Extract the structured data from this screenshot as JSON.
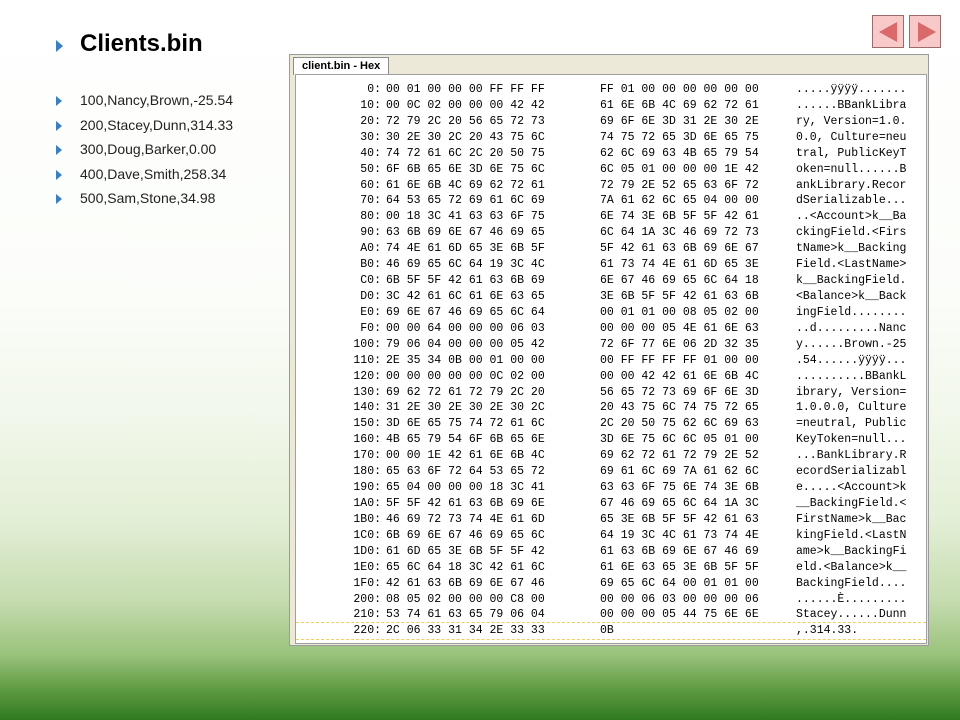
{
  "slide": {
    "title": "Clients.bin",
    "clients": [
      "100,Nancy,Brown,-25.54",
      "200,Stacey,Dunn,314.33",
      "300,Doug,Barker,0.00",
      "400,Dave,Smith,258.34",
      "500,Sam,Stone,34.98"
    ],
    "bullet_icon": "triangle-right-icon",
    "nav": {
      "prev_icon": "triangle-left-icon",
      "next_icon": "triangle-right-icon"
    }
  },
  "hex_viewer": {
    "tab_title": "client.bin - Hex",
    "rows": [
      {
        "offset": "0:",
        "bytes1": "00 01 00 00 00 FF FF FF",
        "bytes2": "FF 01 00 00 00 00 00 00",
        "ascii": ".....ÿÿÿÿ......."
      },
      {
        "offset": "10:",
        "bytes1": "00 0C 02 00 00 00 42 42",
        "bytes2": "61 6E 6B 4C 69 62 72 61",
        "ascii": "......BBankLibra"
      },
      {
        "offset": "20:",
        "bytes1": "72 79 2C 20 56 65 72 73",
        "bytes2": "69 6F 6E 3D 31 2E 30 2E",
        "ascii": "ry, Version=1.0."
      },
      {
        "offset": "30:",
        "bytes1": "30 2E 30 2C 20 43 75 6C",
        "bytes2": "74 75 72 65 3D 6E 65 75",
        "ascii": "0.0, Culture=neu"
      },
      {
        "offset": "40:",
        "bytes1": "74 72 61 6C 2C 20 50 75",
        "bytes2": "62 6C 69 63 4B 65 79 54",
        "ascii": "tral, PublicKeyT"
      },
      {
        "offset": "50:",
        "bytes1": "6F 6B 65 6E 3D 6E 75 6C",
        "bytes2": "6C 05 01 00 00 00 1E 42",
        "ascii": "oken=null......B"
      },
      {
        "offset": "60:",
        "bytes1": "61 6E 6B 4C 69 62 72 61",
        "bytes2": "72 79 2E 52 65 63 6F 72",
        "ascii": "ankLibrary.Recor"
      },
      {
        "offset": "70:",
        "bytes1": "64 53 65 72 69 61 6C 69",
        "bytes2": "7A 61 62 6C 65 04 00 00",
        "ascii": "dSerializable..."
      },
      {
        "offset": "80:",
        "bytes1": "00 18 3C 41 63 63 6F 75",
        "bytes2": "6E 74 3E 6B 5F 5F 42 61",
        "ascii": "..<Account>k__Ba"
      },
      {
        "offset": "90:",
        "bytes1": "63 6B 69 6E 67 46 69 65",
        "bytes2": "6C 64 1A 3C 46 69 72 73",
        "ascii": "ckingField.<Firs"
      },
      {
        "offset": "A0:",
        "bytes1": "74 4E 61 6D 65 3E 6B 5F",
        "bytes2": "5F 42 61 63 6B 69 6E 67",
        "ascii": "tName>k__Backing"
      },
      {
        "offset": "B0:",
        "bytes1": "46 69 65 6C 64 19 3C 4C",
        "bytes2": "61 73 74 4E 61 6D 65 3E",
        "ascii": "Field.<LastName>"
      },
      {
        "offset": "C0:",
        "bytes1": "6B 5F 5F 42 61 63 6B 69",
        "bytes2": "6E 67 46 69 65 6C 64 18",
        "ascii": "k__BackingField."
      },
      {
        "offset": "D0:",
        "bytes1": "3C 42 61 6C 61 6E 63 65",
        "bytes2": "3E 6B 5F 5F 42 61 63 6B",
        "ascii": "<Balance>k__Back"
      },
      {
        "offset": "E0:",
        "bytes1": "69 6E 67 46 69 65 6C 64",
        "bytes2": "00 01 01 00 08 05 02 00",
        "ascii": "ingField........"
      },
      {
        "offset": "F0:",
        "bytes1": "00 00 64 00 00 00 06 03",
        "bytes2": "00 00 00 05 4E 61 6E 63",
        "ascii": "..d.........Nanc"
      },
      {
        "offset": "100:",
        "bytes1": "79 06 04 00 00 00 05 42",
        "bytes2": "72 6F 77 6E 06 2D 32 35",
        "ascii": "y......Brown.-25"
      },
      {
        "offset": "110:",
        "bytes1": "2E 35 34 0B 00 01 00 00",
        "bytes2": "00 FF FF FF FF 01 00 00",
        "ascii": ".54......ÿÿÿÿ..."
      },
      {
        "offset": "120:",
        "bytes1": "00 00 00 00 00 0C 02 00",
        "bytes2": "00 00 42 42 61 6E 6B 4C",
        "ascii": "..........BBankL"
      },
      {
        "offset": "130:",
        "bytes1": "69 62 72 61 72 79 2C 20",
        "bytes2": "56 65 72 73 69 6F 6E 3D",
        "ascii": "ibrary, Version="
      },
      {
        "offset": "140:",
        "bytes1": "31 2E 30 2E 30 2E 30 2C",
        "bytes2": "20 43 75 6C 74 75 72 65",
        "ascii": "1.0.0.0, Culture"
      },
      {
        "offset": "150:",
        "bytes1": "3D 6E 65 75 74 72 61 6C",
        "bytes2": "2C 20 50 75 62 6C 69 63",
        "ascii": "=neutral, Public"
      },
      {
        "offset": "160:",
        "bytes1": "4B 65 79 54 6F 6B 65 6E",
        "bytes2": "3D 6E 75 6C 6C 05 01 00",
        "ascii": "KeyToken=null..."
      },
      {
        "offset": "170:",
        "bytes1": "00 00 1E 42 61 6E 6B 4C",
        "bytes2": "69 62 72 61 72 79 2E 52",
        "ascii": "...BankLibrary.R"
      },
      {
        "offset": "180:",
        "bytes1": "65 63 6F 72 64 53 65 72",
        "bytes2": "69 61 6C 69 7A 61 62 6C",
        "ascii": "ecordSerializabl"
      },
      {
        "offset": "190:",
        "bytes1": "65 04 00 00 00 18 3C 41",
        "bytes2": "63 63 6F 75 6E 74 3E 6B",
        "ascii": "e.....<Account>k"
      },
      {
        "offset": "1A0:",
        "bytes1": "5F 5F 42 61 63 6B 69 6E",
        "bytes2": "67 46 69 65 6C 64 1A 3C",
        "ascii": "__BackingField.<"
      },
      {
        "offset": "1B0:",
        "bytes1": "46 69 72 73 74 4E 61 6D",
        "bytes2": "65 3E 6B 5F 5F 42 61 63",
        "ascii": "FirstName>k__Bac"
      },
      {
        "offset": "1C0:",
        "bytes1": "6B 69 6E 67 46 69 65 6C",
        "bytes2": "64 19 3C 4C 61 73 74 4E",
        "ascii": "kingField.<LastN"
      },
      {
        "offset": "1D0:",
        "bytes1": "61 6D 65 3E 6B 5F 5F 42",
        "bytes2": "61 63 6B 69 6E 67 46 69",
        "ascii": "ame>k__BackingFi"
      },
      {
        "offset": "1E0:",
        "bytes1": "65 6C 64 18 3C 42 61 6C",
        "bytes2": "61 6E 63 65 3E 6B 5F 5F",
        "ascii": "eld.<Balance>k__"
      },
      {
        "offset": "1F0:",
        "bytes1": "42 61 63 6B 69 6E 67 46",
        "bytes2": "69 65 6C 64 00 01 01 00",
        "ascii": "BackingField...."
      },
      {
        "offset": "200:",
        "bytes1": "08 05 02 00 00 00 C8 00",
        "bytes2": "00 00 06 03 00 00 00 06",
        "ascii": "......È........."
      },
      {
        "offset": "210:",
        "bytes1": "53 74 61 63 65 79 06 04",
        "bytes2": "00 00 00 05 44 75 6E 6E",
        "ascii": "Stacey......Dunn"
      },
      {
        "offset": "220:",
        "bytes1": "2C 06 33 31 34 2E 33 33",
        "bytes2": "0B",
        "ascii": ",.314.33."
      }
    ]
  }
}
